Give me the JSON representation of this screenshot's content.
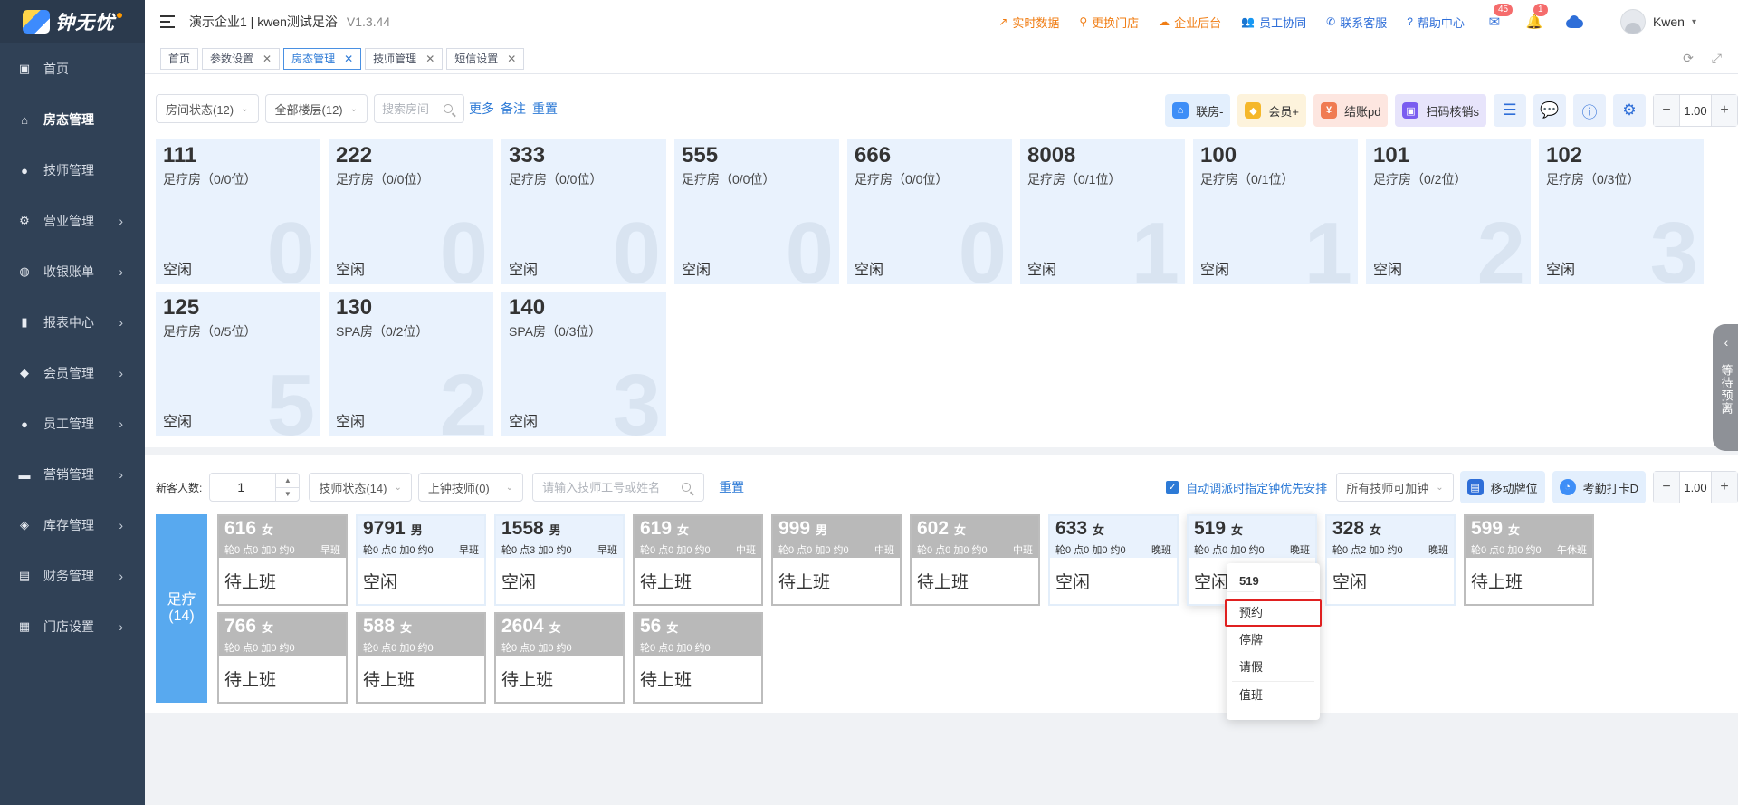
{
  "brand": {
    "name": "钟无忧"
  },
  "header": {
    "title": "演示企业1 | kwen测试足浴",
    "version": "V1.3.44",
    "links": [
      {
        "label": "实时数据",
        "color": "#f07c12",
        "icon": "trend-icon"
      },
      {
        "label": "更换门店",
        "color": "#f07c12",
        "icon": "search-icon"
      },
      {
        "label": "企业后台",
        "color": "#f07c12",
        "icon": "cloud-icon"
      },
      {
        "label": "员工协同",
        "color": "#2e6ed8",
        "icon": "users-icon"
      },
      {
        "label": "联系客服",
        "color": "#2e6ed8",
        "icon": "phone-icon"
      },
      {
        "label": "帮助中心",
        "color": "#2e6ed8",
        "icon": "help-icon"
      }
    ],
    "mail_badge": "45",
    "bell_badge": "1",
    "user": "Kwen"
  },
  "sidebar": {
    "items": [
      {
        "label": "首页",
        "icon": "dashboard-icon",
        "arrow": false
      },
      {
        "label": "房态管理",
        "icon": "home-icon",
        "arrow": false,
        "active": true
      },
      {
        "label": "技师管理",
        "icon": "user-icon",
        "arrow": false
      },
      {
        "label": "营业管理",
        "icon": "gear-icon",
        "arrow": true
      },
      {
        "label": "收银账单",
        "icon": "moneybag-icon",
        "arrow": true
      },
      {
        "label": "报表中心",
        "icon": "bar-chart-icon",
        "arrow": true
      },
      {
        "label": "会员管理",
        "icon": "diamond-icon",
        "arrow": true
      },
      {
        "label": "员工管理",
        "icon": "user-icon",
        "arrow": true
      },
      {
        "label": "营销管理",
        "icon": "briefcase-icon",
        "arrow": true
      },
      {
        "label": "库存管理",
        "icon": "box-icon",
        "arrow": true
      },
      {
        "label": "财务管理",
        "icon": "wallet-icon",
        "arrow": true
      },
      {
        "label": "门店设置",
        "icon": "grid-icon",
        "arrow": true
      }
    ]
  },
  "tabs": [
    {
      "label": "首页",
      "closable": false
    },
    {
      "label": "参数设置",
      "closable": true
    },
    {
      "label": "房态管理",
      "closable": true,
      "active": true
    },
    {
      "label": "技师管理",
      "closable": true
    },
    {
      "label": "短信设置",
      "closable": true
    }
  ],
  "rooms_toolbar": {
    "room_status": "房间状态(12)",
    "floor": "全部楼层(12)",
    "search_placeholder": "搜索房间",
    "more": "更多",
    "note": "备注",
    "reset": "重置",
    "buttons": [
      "联房-",
      "会员+",
      "结账pd",
      "扫码核销s"
    ],
    "zoom": "1.00"
  },
  "rooms": [
    {
      "no": "111",
      "type": "足疗房（0/0位）",
      "count": "0",
      "status": "空闲"
    },
    {
      "no": "222",
      "type": "足疗房（0/0位）",
      "count": "0",
      "status": "空闲"
    },
    {
      "no": "333",
      "type": "足疗房（0/0位）",
      "count": "0",
      "status": "空闲"
    },
    {
      "no": "555",
      "type": "足疗房（0/0位）",
      "count": "0",
      "status": "空闲"
    },
    {
      "no": "666",
      "type": "足疗房（0/0位）",
      "count": "0",
      "status": "空闲"
    },
    {
      "no": "8008",
      "type": "足疗房（0/1位）",
      "count": "1",
      "status": "空闲"
    },
    {
      "no": "100",
      "type": "足疗房（0/1位）",
      "count": "1",
      "status": "空闲"
    },
    {
      "no": "101",
      "type": "足疗房（0/2位）",
      "count": "2",
      "status": "空闲"
    },
    {
      "no": "102",
      "type": "足疗房（0/3位）",
      "count": "3",
      "status": "空闲"
    },
    {
      "no": "125",
      "type": "足疗房（0/5位）",
      "count": "5",
      "status": "空闲"
    },
    {
      "no": "130",
      "type": "SPA房（0/2位）",
      "count": "2",
      "status": "空闲"
    },
    {
      "no": "140",
      "type": "SPA房（0/3位）",
      "count": "3",
      "status": "空闲"
    }
  ],
  "float_tab": {
    "label": "等待预离"
  },
  "tech_toolbar": {
    "new_guest_label": "新客人数:",
    "new_guest_value": "1",
    "tech_status": "技师状态(14)",
    "on_clock": "上钟技师(0)",
    "search_placeholder": "请输入技师工号或姓名",
    "reset": "重置",
    "auto_dispatch": "自动调派时指定钟优先安排",
    "add_clock": "所有技师可加钟",
    "move_card": "移动牌位",
    "attendance": "考勤打卡D",
    "zoom": "1.00"
  },
  "tech_group": {
    "name": "足疗",
    "count": "(14)"
  },
  "techs": [
    {
      "no": "616",
      "sex": "女",
      "stats": "轮0 点0 加0 约0",
      "shift": "早班",
      "status": "待上班",
      "idle": false
    },
    {
      "no": "9791",
      "sex": "男",
      "stats": "轮0 点0 加0 约0",
      "shift": "早班",
      "status": "空闲",
      "idle": true
    },
    {
      "no": "1558",
      "sex": "男",
      "stats": "轮0 点3 加0 约0",
      "shift": "早班",
      "status": "空闲",
      "idle": true
    },
    {
      "no": "619",
      "sex": "女",
      "stats": "轮0 点0 加0 约0",
      "shift": "中班",
      "status": "待上班",
      "idle": false
    },
    {
      "no": "999",
      "sex": "男",
      "stats": "轮0 点0 加0 约0",
      "shift": "中班",
      "status": "待上班",
      "idle": false
    },
    {
      "no": "602",
      "sex": "女",
      "stats": "轮0 点0 加0 约0",
      "shift": "中班",
      "status": "待上班",
      "idle": false
    },
    {
      "no": "633",
      "sex": "女",
      "stats": "轮0 点0 加0 约0",
      "shift": "晚班",
      "status": "空闲",
      "idle": true
    },
    {
      "no": "519",
      "sex": "女",
      "stats": "轮0 点0 加0 约0",
      "shift": "晚班",
      "status": "空闲",
      "idle": true
    },
    {
      "no": "328",
      "sex": "女",
      "stats": "轮0 点2 加0 约0",
      "shift": "晚班",
      "status": "空闲",
      "idle": true
    },
    {
      "no": "599",
      "sex": "女",
      "stats": "轮0 点0 加0 约0",
      "shift": "午休班",
      "status": "待上班",
      "idle": false
    },
    {
      "no": "766",
      "sex": "女",
      "stats": "轮0 点0 加0 约0",
      "shift": "",
      "status": "待上班",
      "idle": false
    },
    {
      "no": "588",
      "sex": "女",
      "stats": "轮0 点0 加0 约0",
      "shift": "",
      "status": "待上班",
      "idle": false
    },
    {
      "no": "2604",
      "sex": "女",
      "stats": "轮0 点0 加0 约0",
      "shift": "",
      "status": "待上班",
      "idle": false
    },
    {
      "no": "56",
      "sex": "女",
      "stats": "轮0 点0 加0 约0",
      "shift": "",
      "status": "待上班",
      "idle": false
    }
  ],
  "popup": {
    "title": "519",
    "items": [
      "预约",
      "停牌",
      "请假",
      "值班"
    ]
  }
}
